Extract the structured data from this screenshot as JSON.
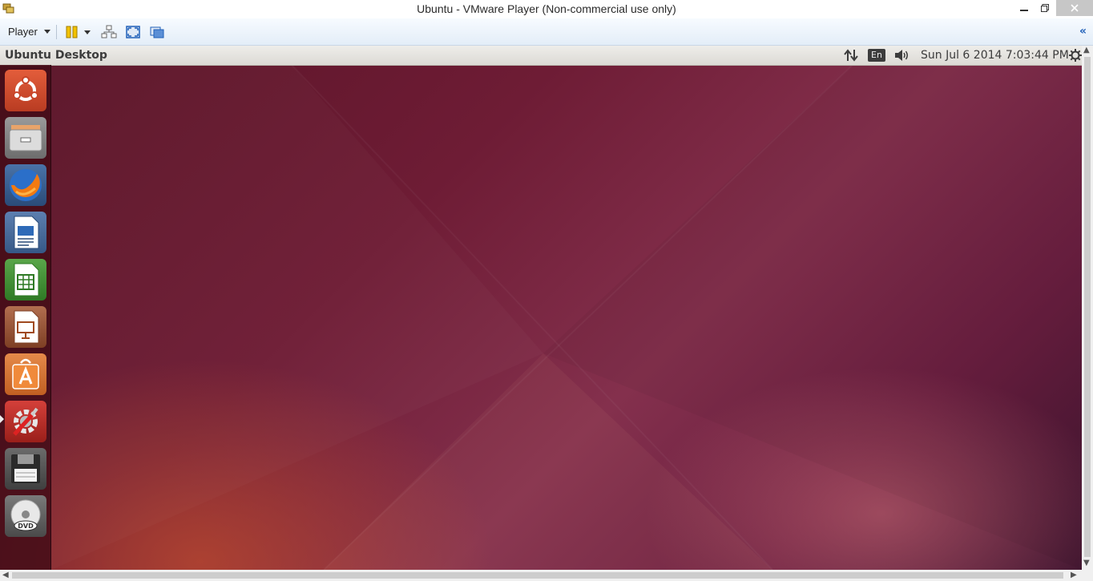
{
  "window": {
    "title": "Ubuntu - VMware Player (Non-commercial use only)",
    "icon": "vmware-icon"
  },
  "toolbar": {
    "player_label": "Player"
  },
  "panel": {
    "title": "Ubuntu Desktop",
    "language": "En",
    "clock": "Sun Jul  6 2014  7:03:44 PM"
  },
  "launcher": {
    "items": [
      "ubuntu-dash-icon",
      "files-icon",
      "firefox-icon",
      "libreoffice-writer-icon",
      "libreoffice-calc-icon",
      "libreoffice-impress-icon",
      "software-center-icon",
      "system-settings-icon",
      "floppy-disk-icon",
      "dvd-icon"
    ],
    "active_index": 7
  }
}
